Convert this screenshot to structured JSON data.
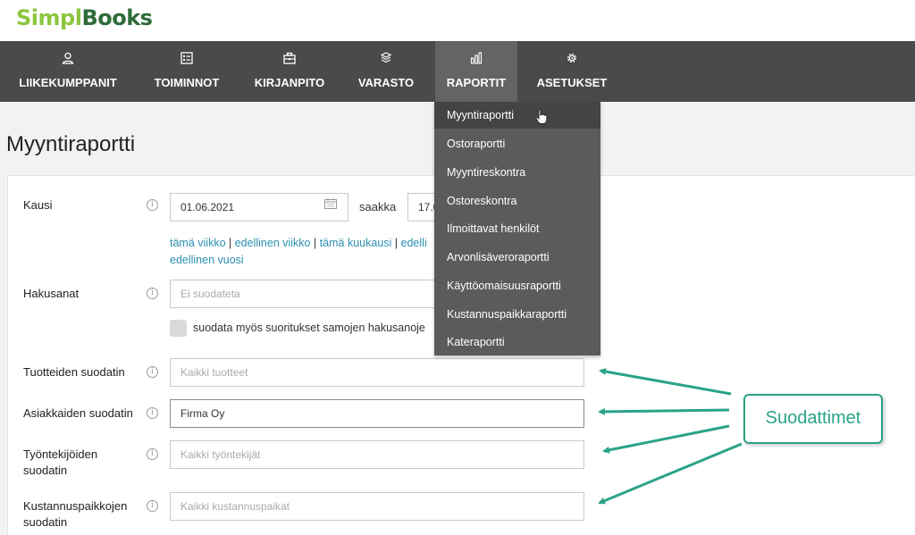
{
  "app": {
    "logo_part1": "Simpl",
    "logo_part2": "Books"
  },
  "nav": {
    "items": [
      {
        "label": "LIIKEKUMPPANIT",
        "icon": "user-icon"
      },
      {
        "label": "TOIMINNOT",
        "icon": "list-icon"
      },
      {
        "label": "KIRJANPITO",
        "icon": "briefcase-icon"
      },
      {
        "label": "VARASTO",
        "icon": "boxes-icon"
      },
      {
        "label": "RAPORTIT",
        "icon": "bar-chart-icon",
        "active": true
      },
      {
        "label": "ASETUKSET",
        "icon": "gear-icon"
      }
    ]
  },
  "dropdown": {
    "items": [
      "Myyntiraportti",
      "Ostoraportti",
      "Myyntireskontra",
      "Ostoreskontra",
      "Ilmoittavat henkilöt",
      "Arvonlisäveroraportti",
      "Käyttöomaisuusraportti",
      "Kustannuspaikkaraportti",
      "Kateraportti"
    ],
    "hovered": "Myyntiraportti"
  },
  "page": {
    "title": "Myyntiraportti"
  },
  "form": {
    "kausi": {
      "label": "Kausi",
      "from_value": "01.06.2021",
      "between_label": "saakka",
      "to_value": "17.0"
    },
    "quick_links": {
      "this_week": "tämä viikko",
      "last_week": "edellinen viikko",
      "this_month": "tämä kuukausi",
      "prev_partial": "edelli",
      "prev_year": "edellinen vuosi",
      "separator": " | "
    },
    "hakusanat": {
      "label": "Hakusanat",
      "placeholder": "Ei suodateta"
    },
    "checkbox_label": "suodata myös suoritukset samojen hakusanoje",
    "tuotteet": {
      "label": "Tuotteiden suodatin",
      "placeholder": "Kaikki tuotteet"
    },
    "asiakkaat": {
      "label": "Asiakkaiden suodatin",
      "value": "Firma Oy"
    },
    "tyontekijat": {
      "label_line1": "Työntekijöiden",
      "label_line2": "suodatin",
      "placeholder": "Kaikki työntekijät"
    },
    "kustannuspaikat": {
      "label_line1": "Kustannuspaikkojen",
      "label_line2": "suodatin",
      "placeholder": "Kaikki kustannuspaikat"
    }
  },
  "callout": {
    "text": "Suodattimet"
  },
  "colors": {
    "nav_bg": "#4a4a4a",
    "accent": "#2aa387",
    "link": "#2c8fb0",
    "logo_green": "#8cc63f",
    "logo_dark": "#2f6b3a"
  }
}
